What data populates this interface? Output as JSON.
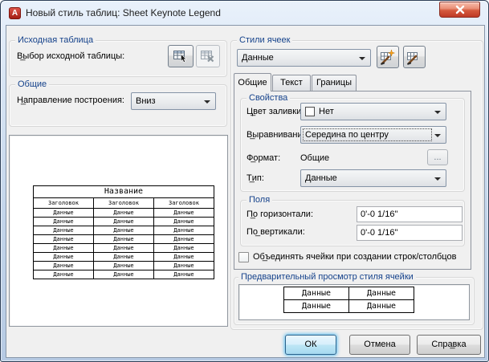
{
  "window": {
    "title": "Новый стиль таблиц: Sheet Keynote Legend",
    "app_icon_letter": "A"
  },
  "colors": {
    "group_label": "#15428b",
    "close_button_red": "#c33a24",
    "default_button_glow": "#40b4f0",
    "titlebar_gradient_top": "#e9f1fb",
    "dialog_background": "#f0f0f0"
  },
  "icons": {
    "app": "autocad-a-icon",
    "close": "close-x-icon",
    "select_table": "table-cursor-icon",
    "remove_table": "table-x-icon",
    "new_cell_style": "table-brush-star-icon",
    "manage_cell_styles": "table-brush-icon",
    "dropdown": "chevron-down-icon",
    "fill_swatch": "white-color-swatch"
  },
  "source_table_group": {
    "title": "Исходная таблица",
    "label": "В̲ыбор исходной таблицы:"
  },
  "general_group": {
    "title": "Общие",
    "direction_label": "Н̲аправление построения:",
    "direction_value": "Вниз"
  },
  "table_preview": {
    "title": "Название",
    "header": "Заголовок",
    "cell": "Данные",
    "columns": 3,
    "data_rows": 8
  },
  "cell_styles_group": {
    "title": "Стили ячеек",
    "style_value": "Данные",
    "tabs": [
      "Общие",
      "Текст",
      "Границы"
    ],
    "active_tab": "Общие"
  },
  "properties_group": {
    "title": "Свойства",
    "fill_label": "Ц̲вет заливки:",
    "fill_value": "Нет",
    "align_label": "В̲ыравнивание:",
    "align_value": "Середина по центру",
    "format_label": "Ф̲ормат:",
    "format_value": "Общие",
    "format_button": "...",
    "type_label": "Т̲ип:",
    "type_value": "Данные"
  },
  "margins_group": {
    "title": "Поля",
    "horizontal_label": "П̲о горизонтали:",
    "horizontal_value": "0'-0 1/16\"",
    "vertical_label": "По̲ вертикали:",
    "vertical_value": "0'-0 1/16\""
  },
  "merge_checkbox": {
    "label": "Об̲ъединять ячейки при создании строк/столбцов",
    "checked": false
  },
  "cell_preview_group": {
    "title": "Предварительный просмотр стиля ячейки",
    "cell": "Данные",
    "rows": 2,
    "columns": 2
  },
  "footer": {
    "ok": "ОК",
    "cancel": "Отмена",
    "help": "Спра̲вка"
  }
}
